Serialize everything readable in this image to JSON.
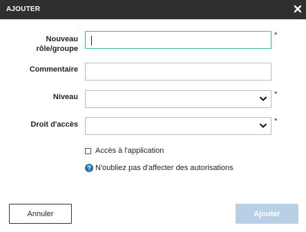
{
  "dialog": {
    "title": "AJOUTER",
    "close_icon": "close-icon"
  },
  "form": {
    "role_label_line1": "Nouveau",
    "role_label_line2": "rôle/groupe",
    "role_value": "",
    "comment_label": "Commentaire",
    "comment_value": "",
    "level_label": "Niveau",
    "level_value": "",
    "access_label": "Droit d'accès",
    "access_value": "",
    "required_mark": "*",
    "app_access_checkbox_label": "Accès à l'application",
    "app_access_checked": false,
    "info_text": "N'oubliez pas d'affecter des autorisations"
  },
  "buttons": {
    "cancel_label": "Annuler",
    "add_label": "Ajouter"
  },
  "colors": {
    "titlebar": "#2f2f2f",
    "focus_border": "#2fbfa3",
    "primary_disabled": "#b8d0e5",
    "info_icon": "#1f6fb5"
  }
}
